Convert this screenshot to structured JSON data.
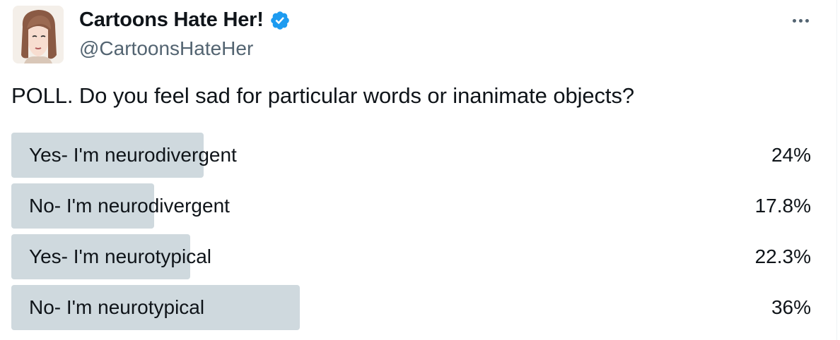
{
  "tweet": {
    "author": {
      "display_name": "Cartoons Hate Her!",
      "handle": "@CartoonsHateHer",
      "verified": true,
      "verified_color": "#1d9bf0"
    },
    "more_icon": "more-horizontal-icon",
    "text": "POLL. Do you feel sad for particular words or inanimate objects?"
  },
  "poll": {
    "bar_color": "#cfd9de",
    "options": [
      {
        "label": "Yes- I'm neurodivergent",
        "percent_text": "24%",
        "percent": 24
      },
      {
        "label": "No- I'm neurodivergent",
        "percent_text": "17.8%",
        "percent": 17.8
      },
      {
        "label": "Yes- I'm neurotypical",
        "percent_text": "22.3%",
        "percent": 22.3
      },
      {
        "label": "No- I'm neurotypical",
        "percent_text": "36%",
        "percent": 36
      }
    ]
  }
}
